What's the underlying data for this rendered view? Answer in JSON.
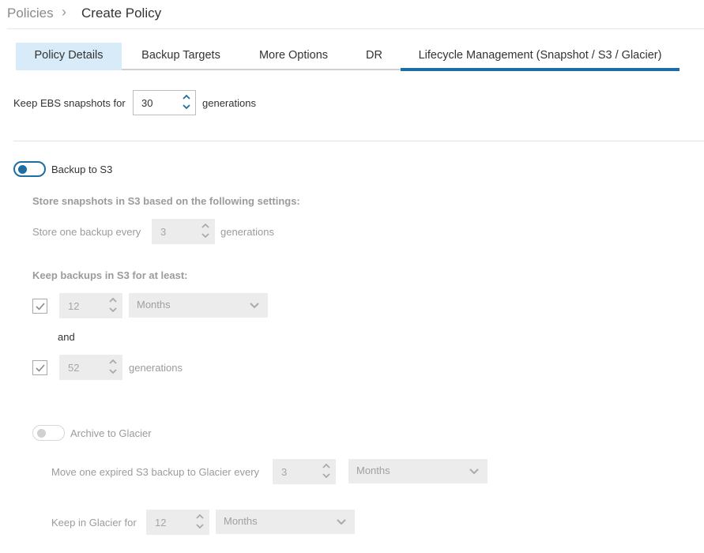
{
  "breadcrumb": {
    "parent": "Policies",
    "separator": "›",
    "current": "Create Policy"
  },
  "tabs": [
    {
      "label": "Policy Details"
    },
    {
      "label": "Backup Targets"
    },
    {
      "label": "More Options"
    },
    {
      "label": "DR"
    },
    {
      "label": "Lifecycle Management (Snapshot / S3 / Glacier)"
    }
  ],
  "ebs": {
    "prefix": "Keep EBS snapshots for",
    "value": "30",
    "suffix": "generations"
  },
  "s3": {
    "toggle_label": "Backup to S3",
    "enabled": true,
    "settings_heading": "Store snapshots in S3 based on the following settings:",
    "store_every_label": "Store one backup every",
    "store_every_value": "3",
    "store_every_suffix": "generations",
    "keep_heading": "Keep backups in S3 for at least:",
    "keep_period_value": "12",
    "keep_period_unit": "Months",
    "and_label": "and",
    "keep_generations_value": "52",
    "keep_generations_suffix": "generations",
    "keep_period_checked": true,
    "keep_generations_checked": true
  },
  "glacier": {
    "toggle_label": "Archive to Glacier",
    "enabled": false,
    "move_label": "Move one expired S3 backup to Glacier every",
    "move_value": "3",
    "move_unit": "Months",
    "keep_label": "Keep in Glacier for",
    "keep_value": "12",
    "keep_unit": "Months"
  },
  "colors": {
    "accent": "#1c6ea4",
    "active_tab_bg": "#d8ebf8",
    "disabled_field": "#ececec"
  }
}
